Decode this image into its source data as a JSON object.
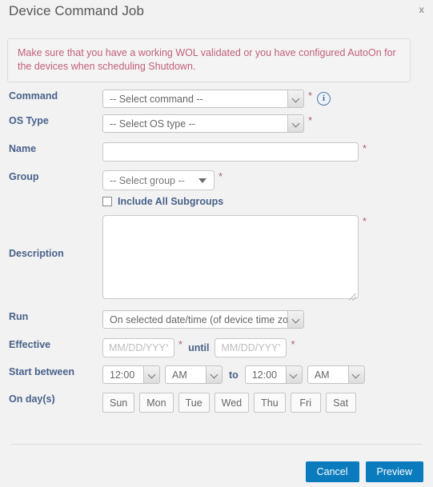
{
  "dialog": {
    "title": "Device Command Job",
    "close_label": "x",
    "warning": "Make sure that you have a working WOL validated or you have configured AutoOn for the devices when scheduling Shutdown."
  },
  "fields": {
    "command": {
      "label": "Command",
      "value": "-- Select command --",
      "required_marker": "*",
      "info_icon_label": "i"
    },
    "os_type": {
      "label": "OS Type",
      "value": "-- Select OS type --",
      "required_marker": "*"
    },
    "name": {
      "label": "Name",
      "value": "",
      "placeholder": "",
      "required_marker": "*"
    },
    "group": {
      "label": "Group",
      "value": "-- Select group --",
      "required_marker": "*"
    },
    "include_all_subgroups": {
      "label": "Include All Subgroups",
      "checked": false
    },
    "description": {
      "label": "Description",
      "value": "",
      "placeholder": "",
      "required_marker": "*"
    },
    "run": {
      "label": "Run",
      "value": "On selected date/time (of device time zo"
    },
    "effective": {
      "label": "Effective",
      "from_value": "",
      "from_placeholder": "MM/DD/YYYY",
      "from_required_marker": "*",
      "until_label": "until",
      "to_value": "",
      "to_placeholder": "MM/DD/YYYY",
      "to_required_marker": "*"
    },
    "start_between": {
      "label": "Start between",
      "from_time": "12:00",
      "from_meridiem": "AM",
      "to_word": "to",
      "to_time": "12:00",
      "to_meridiem": "AM"
    },
    "on_days": {
      "label": "On day(s)",
      "days": [
        "Sun",
        "Mon",
        "Tue",
        "Wed",
        "Thu",
        "Fri",
        "Sat"
      ]
    }
  },
  "footer": {
    "cancel_label": "Cancel",
    "preview_label": "Preview"
  },
  "colors": {
    "accent_button": "#0a7bbd",
    "label_text": "#49628a",
    "warning_text": "#c0607a",
    "required_marker": "#b05a6e",
    "page_background": "#f2f2f2"
  }
}
